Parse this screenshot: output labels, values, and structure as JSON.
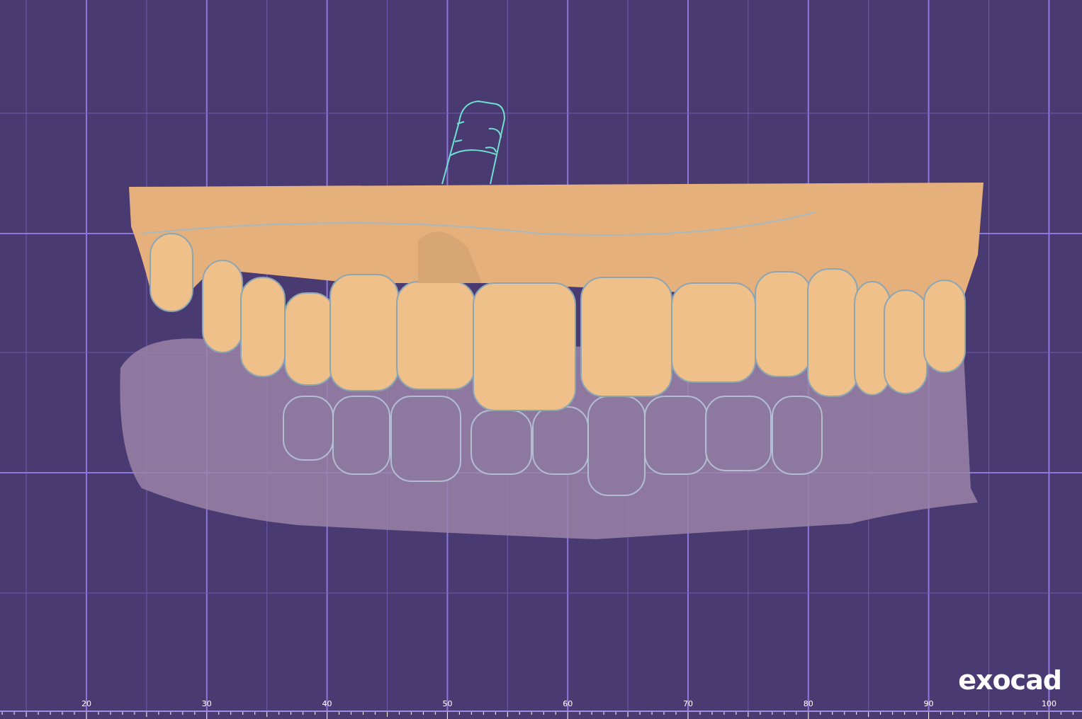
{
  "viewport": {
    "ruler": {
      "labels": [
        "20",
        "30",
        "40",
        "50",
        "60",
        "70",
        "80",
        "90",
        "100"
      ]
    }
  },
  "logo": "exocad"
}
